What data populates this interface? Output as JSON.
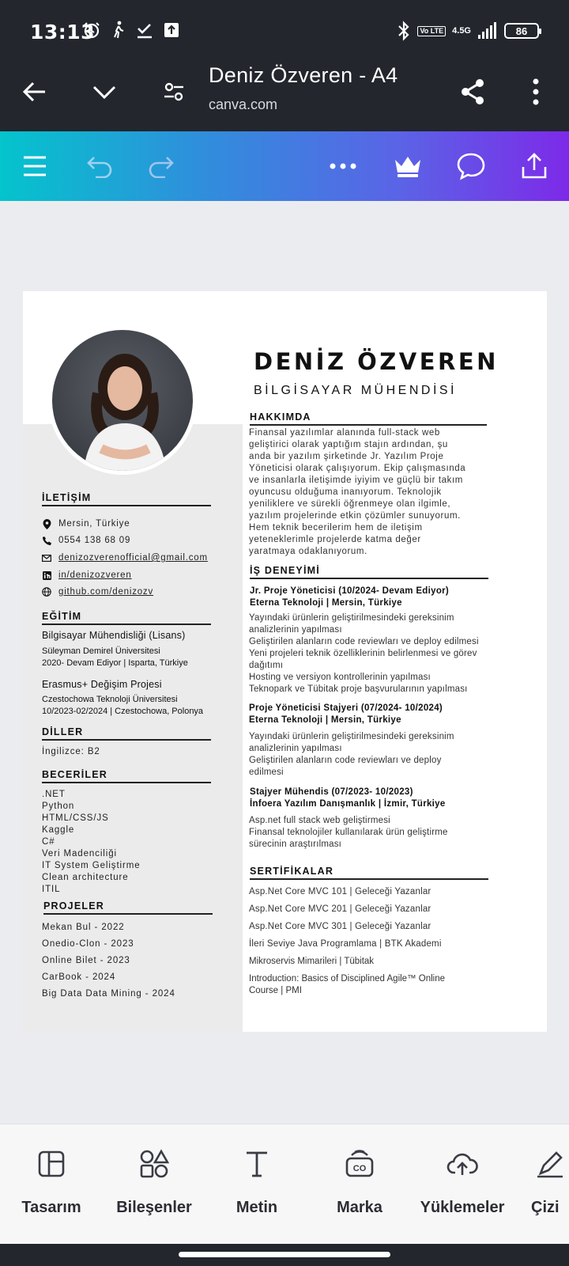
{
  "status_bar": {
    "time": "13:13",
    "network": "4.5G",
    "lte": "Vo LTE",
    "battery": "86"
  },
  "browser": {
    "title": "Deniz Özveren - A4",
    "url": "canva.com"
  },
  "toolbar": {
    "icons": [
      "menu-icon",
      "undo-icon",
      "redo-icon",
      "more-icon",
      "crown-icon",
      "comment-icon",
      "share-upload-icon"
    ]
  },
  "resume": {
    "name": "DENİZ ÖZVEREN",
    "title": "BİLGİSAYAR MÜHENDİSİ",
    "contact": {
      "heading": "İLETİŞİM",
      "location": "Mersin, Türkiye",
      "phone": "0554 138 68 09",
      "email": "denizozverenofficial@gmail.com",
      "linkedin": "in/denizozveren",
      "github": "github.com/denizozv"
    },
    "education": {
      "heading": "EĞİTİM",
      "degree": "Bilgisayar Mühendisliği (Lisans)",
      "school": "Süleyman Demirel Üniversitesi",
      "school_detail": "2020- Devam Ediyor | Isparta, Türkiye",
      "exchange": "Erasmus+ Değişim Projesi",
      "exchange_school": "Czestochowa Teknoloji Üniversitesi",
      "exchange_detail": "10/2023-02/2024 | Czestochowa, Polonya"
    },
    "languages": {
      "heading": "DİLLER",
      "items": [
        "İngilizce: B2"
      ]
    },
    "skills": {
      "heading": "BECERİLER",
      "items": [
        ".NET",
        "Python",
        "HTML/CSS/JS",
        "Kaggle",
        "C#",
        "Veri Madenciliği",
        "IT System Geliştirme",
        "Clean architecture",
        "ITIL"
      ]
    },
    "projects": {
      "heading": "PROJELER",
      "items": [
        "Mekan Bul - 2022",
        "Onedio-Clon - 2023",
        "Online Bilet - 2023",
        "CarBook - 2024",
        "Big Data Data Mining - 2024"
      ]
    },
    "about": {
      "heading": "HAKKIMDA",
      "lines": [
        "Finansal yazılımlar alanında full-stack web",
        "geliştirici olarak yaptığım stajın ardından, şu",
        "anda bir yazılım şirketinde Jr. Yazılım Proje",
        "Yöneticisi olarak çalışıyorum. Ekip çalışmasında",
        "ve insanlarla iletişimde iyiyim ve güçlü bir takım",
        "oyuncusu olduğuma inanıyorum. Teknolojik",
        "yeniliklere ve sürekli öğrenmeye olan ilgimle,",
        "yazılım projelerinde etkin çözümler sunuyorum.",
        "Hem teknik becerilerim hem de iletişim",
        "yeteneklerimle projelerde katma değer",
        "yaratmaya odaklanıyorum."
      ]
    },
    "experience": {
      "heading": "İŞ DENEYİMİ",
      "jobs": [
        {
          "role": "Jr. Proje Yöneticisi (10/2024- Devam Ediyor)",
          "company": "Eterna Teknoloji | Mersin, Türkiye",
          "lines": [
            "Yayındaki ürünlerin geliştirilmesindeki gereksinim",
            "analizlerinin yapılması",
            "Geliştirilen alanların code reviewları ve deploy edilmesi",
            "Yeni projeleri teknik özelliklerinin belirlenmesi ve görev",
            "dağıtımı",
            "Hosting ve versiyon kontrollerinin yapılması",
            "Teknopark ve Tübitak proje başvurularının yapılması"
          ]
        },
        {
          "role": "Proje Yöneticisi Stajyeri (07/2024- 10/2024)",
          "company": "Eterna Teknoloji | Mersin, Türkiye",
          "lines": [
            "Yayındaki ürünlerin geliştirilmesindeki gereksinim",
            "analizlerinin yapılması",
            "Geliştirilen alanların code reviewları ve deploy",
            "edilmesi"
          ]
        },
        {
          "role": "Stajyer Mühendis (07/2023- 10/2023)",
          "company": "İnfoera Yazılım Danışmanlık | İzmir, Türkiye",
          "lines": [
            "Asp.net full stack web geliştirmesi",
            "Finansal teknolojiler kullanılarak ürün geliştirme",
            "sürecinin araştırılması"
          ]
        }
      ]
    },
    "certificates": {
      "heading": "SERTİFİKALAR",
      "items": [
        "Asp.Net Core MVC 101 | Geleceği Yazanlar",
        "Asp.Net Core MVC 201 | Geleceği Yazanlar",
        "Asp.Net Core MVC 301 | Geleceği Yazanlar",
        "İleri Seviye Java Programlama | BTK Akademi",
        "Mikroservis Mimarileri | Tübitak",
        "Introduction: Basics of Disciplined Agile™  Online",
        "Course | PMI"
      ]
    }
  },
  "bottom_nav": {
    "items": [
      {
        "label": "Tasarım",
        "icon": "design-icon"
      },
      {
        "label": "Bileşenler",
        "icon": "elements-icon"
      },
      {
        "label": "Metin",
        "icon": "text-icon"
      },
      {
        "label": "Marka",
        "icon": "brand-icon"
      },
      {
        "label": "Yüklemeler",
        "icon": "uploads-icon"
      },
      {
        "label": "Çizi",
        "icon": "draw-icon"
      }
    ]
  }
}
